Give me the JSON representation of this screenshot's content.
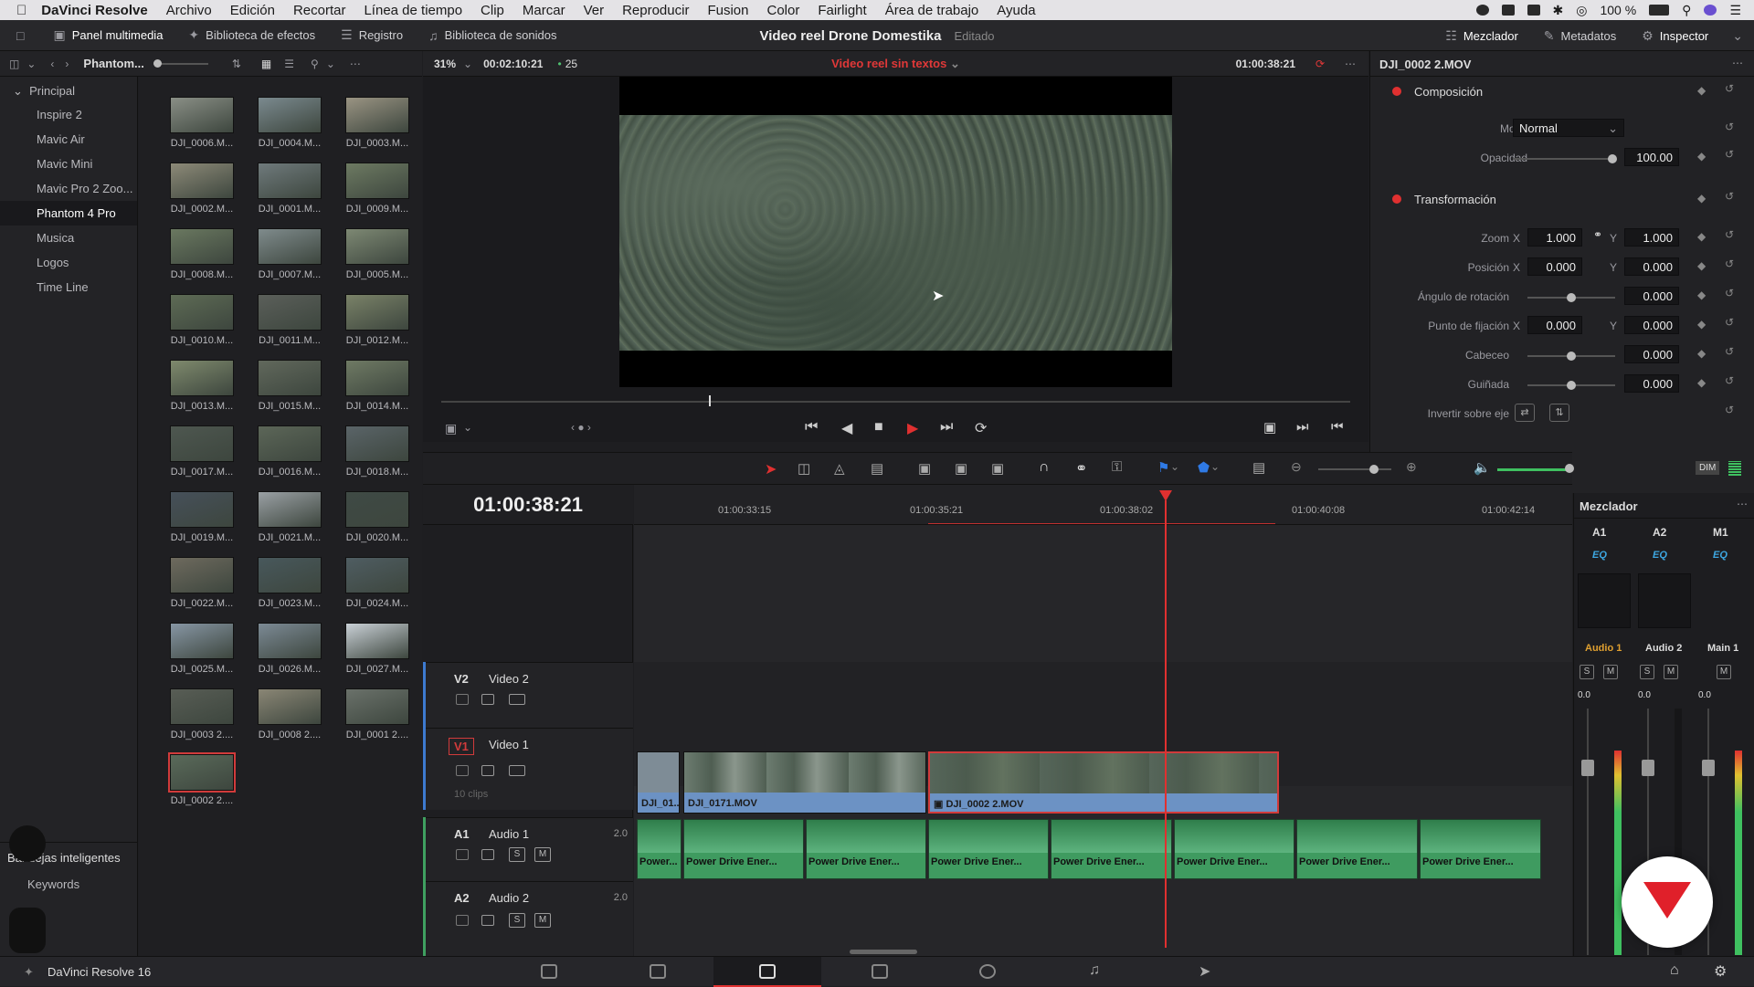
{
  "menubar": {
    "app": "DaVinci Resolve",
    "items": [
      "Archivo",
      "Edición",
      "Recortar",
      "Línea de tiempo",
      "Clip",
      "Marcar",
      "Ver",
      "Reproducir",
      "Fusion",
      "Color",
      "Fairlight",
      "Área de trabajo",
      "Ayuda"
    ],
    "battery": "100 %"
  },
  "toolbar": {
    "media_pool": "Panel multimedia",
    "effects": "Biblioteca de efectos",
    "log": "Registro",
    "sounds": "Biblioteca de sonidos",
    "project_title": "Video reel Drone Domestika",
    "project_status": "Editado",
    "mixer": "Mezclador",
    "metadata": "Metadatos",
    "inspector": "Inspector"
  },
  "subbar": {
    "bin_name": "Phantom...",
    "zoom": "31%",
    "duration": "00:02:10:21",
    "fps": "25",
    "timeline_name": "Video reel sin textos",
    "timecode": "01:00:38:21",
    "clip_name": "DJI_0002 2.MOV"
  },
  "sidebar": {
    "root": "Principal",
    "items": [
      "Inspire 2",
      "Mavic Air",
      "Mavic Mini",
      "Mavic Pro 2 Zoo...",
      "Phantom 4 Pro",
      "Musica",
      "Logos",
      "Time Line"
    ],
    "smart_bins": "Bandejas inteligentes",
    "keywords": "Keywords"
  },
  "media": {
    "clips": [
      "DJI_0006.M...",
      "DJI_0004.M...",
      "DJI_0003.M...",
      "DJI_0002.M...",
      "DJI_0001.M...",
      "DJI_0009.M...",
      "DJI_0008.M...",
      "DJI_0007.M...",
      "DJI_0005.M...",
      "DJI_0010.M...",
      "DJI_0011.M...",
      "DJI_0012.M...",
      "DJI_0013.M...",
      "DJI_0015.M...",
      "DJI_0014.M...",
      "DJI_0017.M...",
      "DJI_0016.M...",
      "DJI_0018.M...",
      "DJI_0019.M...",
      "DJI_0021.M...",
      "DJI_0020.M...",
      "DJI_0022.M...",
      "DJI_0023.M...",
      "DJI_0024.M...",
      "DJI_0025.M...",
      "DJI_0026.M...",
      "DJI_0027.M...",
      "DJI_0003 2....",
      "DJI_0008 2....",
      "DJI_0001 2....",
      "DJI_0002 2...."
    ]
  },
  "timeline": {
    "timecode": "01:00:38:21",
    "ruler": [
      "01:00:33:15",
      "01:00:35:21",
      "01:00:38:02",
      "01:00:40:08",
      "01:00:42:14"
    ],
    "tracks": {
      "v2": {
        "code": "V2",
        "name": "Video 2"
      },
      "v1": {
        "code": "V1",
        "name": "Video 1",
        "info": "10 clips"
      },
      "a1": {
        "code": "A1",
        "name": "Audio 1",
        "level": "2.0"
      },
      "a2": {
        "code": "A2",
        "name": "Audio 2",
        "level": "2.0"
      }
    },
    "video_clips": [
      "DJI_01...",
      "DJI_0171.MOV",
      "DJI_0002 2.MOV"
    ],
    "audio_clip": "Power Drive Ener...",
    "audio_first": "Power...",
    "solo": "S",
    "mute": "M"
  },
  "inspector": {
    "composition": "Composición",
    "mode_label": "Modo",
    "mode_value": "Normal",
    "opacity_label": "Opacidad",
    "opacity_value": "100.00",
    "transform": "Transformación",
    "zoom_label": "Zoom",
    "zoom_x": "1.000",
    "zoom_y": "1.000",
    "pos_label": "Posición",
    "pos_x": "0.000",
    "pos_y": "0.000",
    "rot_label": "Ángulo de rotación",
    "rot_value": "0.000",
    "anchor_label": "Punto de fijación",
    "anchor_x": "0.000",
    "anchor_y": "0.000",
    "pitch_label": "Cabeceo",
    "pitch_value": "0.000",
    "yaw_label": "Guiñada",
    "yaw_value": "0.000",
    "flip_label": "Invertir sobre eje",
    "x": "X",
    "y": "Y"
  },
  "mixer": {
    "title": "Mezclador",
    "channels": [
      "A1",
      "A2",
      "M1"
    ],
    "names": [
      "Audio 1",
      "Audio 2",
      "Main 1"
    ],
    "eq": "EQ",
    "db": "0.0",
    "dim": "DIM"
  },
  "bottom": {
    "version": "DaVinci Resolve 16"
  },
  "colors": {
    "accent_red": "#e03030",
    "clip_blue": "#6c92c4",
    "audio_green": "#3f9b60",
    "audio1_orange": "#e0a030"
  }
}
